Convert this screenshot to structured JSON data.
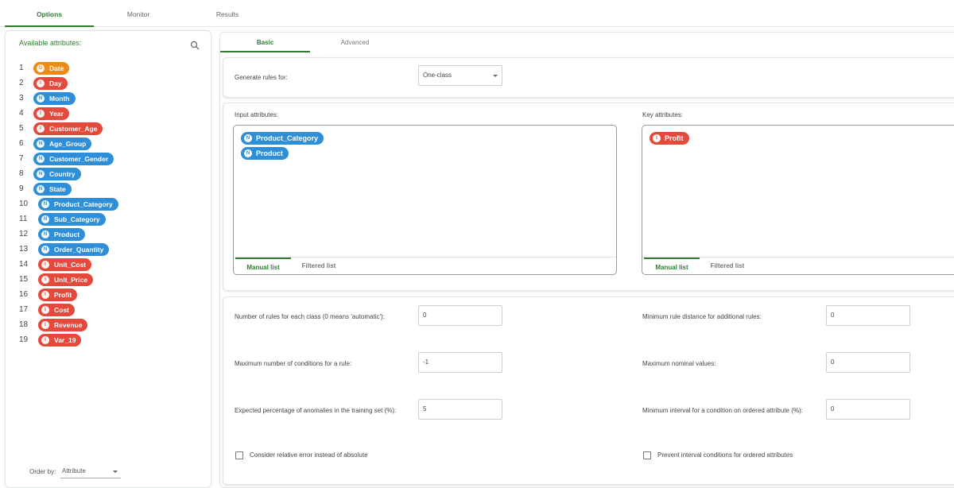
{
  "tabs": [
    "Options",
    "Monitor",
    "Results"
  ],
  "left": {
    "title": "Available attributes:",
    "order_label": "Order by:",
    "order_value": "Attribute",
    "attributes": [
      {
        "num": "1",
        "type": "D",
        "name": "Date"
      },
      {
        "num": "2",
        "type": "I",
        "name": "Day"
      },
      {
        "num": "3",
        "type": "N",
        "name": "Month"
      },
      {
        "num": "4",
        "type": "I",
        "name": "Year"
      },
      {
        "num": "5",
        "type": "I",
        "name": "Customer_Age"
      },
      {
        "num": "6",
        "type": "N",
        "name": "Age_Group"
      },
      {
        "num": "7",
        "type": "N",
        "name": "Customer_Gender"
      },
      {
        "num": "8",
        "type": "N",
        "name": "Country"
      },
      {
        "num": "9",
        "type": "N",
        "name": "State"
      },
      {
        "num": "10",
        "type": "N",
        "name": "Product_Category"
      },
      {
        "num": "11",
        "type": "N",
        "name": "Sub_Category"
      },
      {
        "num": "12",
        "type": "N",
        "name": "Product"
      },
      {
        "num": "13",
        "type": "N",
        "name": "Order_Quantity"
      },
      {
        "num": "14",
        "type": "I",
        "name": "Unit_Cost"
      },
      {
        "num": "15",
        "type": "I",
        "name": "Unit_Price"
      },
      {
        "num": "16",
        "type": "I",
        "name": "Profit"
      },
      {
        "num": "17",
        "type": "I",
        "name": "Cost"
      },
      {
        "num": "18",
        "type": "I",
        "name": "Revenue"
      },
      {
        "num": "19",
        "type": "I",
        "name": "Var_19"
      }
    ]
  },
  "subtabs": [
    "Basic",
    "Advanced"
  ],
  "generate": {
    "label": "Generate rules for:",
    "value": "One-class"
  },
  "input_attrs": {
    "label": "Input attributes:",
    "items": [
      {
        "type": "N",
        "name": "Product_Category"
      },
      {
        "type": "N",
        "name": "Product"
      }
    ],
    "tab_manual": "Manual list",
    "tab_filtered": "Filtered list"
  },
  "key_attrs": {
    "label": "Key attributes:",
    "items": [
      {
        "type": "I",
        "name": "Profit"
      }
    ],
    "tab_manual": "Manual list",
    "tab_filtered": "Filtered list"
  },
  "params": {
    "rules_per_class": {
      "label": "Number of rules for each class (0 means 'automatic'):",
      "value": "0"
    },
    "min_rule_distance": {
      "label": "Minimum rule distance for additional rules:",
      "value": "0"
    },
    "max_conditions": {
      "label": "Maximum number of conditions for a rule:",
      "value": "-1"
    },
    "max_nominal": {
      "label": "Maximum nominal values:",
      "value": "0"
    },
    "expected_anomalies": {
      "label": "Expected percentage of anomalies in the training set (%):",
      "value": "5"
    },
    "min_interval": {
      "label": "Minimum interval for a condition on ordered attribute (%):",
      "value": "0"
    },
    "relative_error": {
      "label": "Consider relative error instead of absolute"
    },
    "prevent_interval": {
      "label": "Prevent interval conditions for ordered attributes"
    }
  }
}
